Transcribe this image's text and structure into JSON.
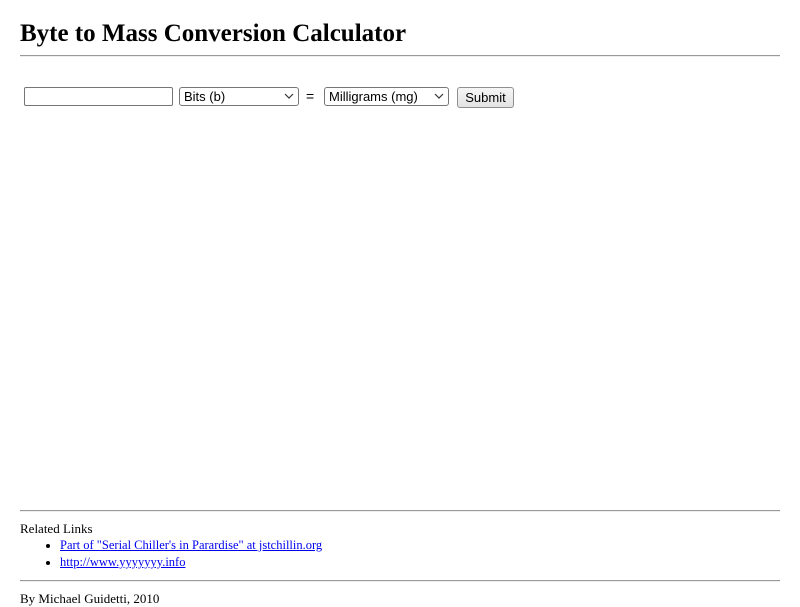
{
  "page": {
    "title": "Byte to Mass Conversion Calculator"
  },
  "converter": {
    "input_value": "",
    "from_unit": "Bits (b)",
    "equals_sign": "=",
    "to_unit": "Milligrams (mg)",
    "submit_label": "Submit"
  },
  "related": {
    "heading": "Related Links",
    "links": [
      {
        "label": "Part of \"Serial Chiller's in Parardise\" at jstchillin.org"
      },
      {
        "label": "http://www.yyyyyyy.info"
      }
    ]
  },
  "footer": {
    "credit": "By Michael Guidetti, 2010"
  },
  "colors": {
    "link": "#0000ee",
    "rule": "#9a9a9a"
  }
}
